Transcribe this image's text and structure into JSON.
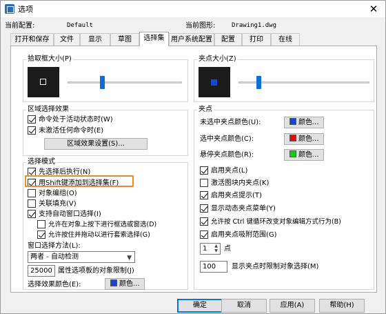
{
  "window": {
    "title": "选项",
    "close": "✕"
  },
  "profile": {
    "current_profile_label": "当前配置:",
    "current_profile_value": "Default",
    "current_drawing_label": "当前图形:",
    "current_drawing_value": "Drawing1.dwg"
  },
  "tabs": [
    "打开和保存",
    "文件",
    "显示",
    "草图",
    "选择集",
    "用户系统配置",
    "配置",
    "打印",
    "在线"
  ],
  "active_tab": "选择集",
  "pickbox": {
    "title": "拾取框大小(P)",
    "slider_level": 0.3
  },
  "grip_size": {
    "title": "夹点大小(Z)",
    "slider_level": 0.15
  },
  "area_effect": {
    "title": "区域选择效果",
    "opt1": "命令处于活动状态时(W)",
    "opt2": "未激活任何命令时(E)",
    "settings_button": "区域效果设置(S)..."
  },
  "selection_mode": {
    "title": "选择模式",
    "opt_noun_verb": "先选择后执行(N)",
    "opt_shift": "用Shift键添加到选择集(F)",
    "opt_group": "对象编组(O)",
    "opt_assoc_hatch": "关联填充(V)",
    "opt_implied": "支持自动窗口选择(I)",
    "opt_allow_press": "允许在对象上按下进行框选或窗选(D)",
    "opt_lasso": "允许按住并拖动以进行套索选择(G)",
    "window_method_label": "窗口选择方法(L):",
    "window_method_value": "两者 - 自动检测",
    "limit_value": "25000",
    "limit_label": "属性选项板的对象限制(J)",
    "effect_color_label": "选择效果颜色(E):",
    "color_button": "颜色..."
  },
  "grips": {
    "title": "夹点",
    "unselected_label": "未选中夹点颜色(U):",
    "selected_label": "选中夹点颜色(C):",
    "hover_label": "悬停夹点颜色(R):",
    "color_button": "颜色...",
    "enable_grips": "启用夹点(L)",
    "grips_in_blocks": "激活图块内夹点(K)",
    "grip_tips": "启用夹点提示(T)",
    "dynamic_menu": "显示动态夹点菜单(Y)",
    "ctrl_cycle": "允许按 Ctrl 键循环改变对象编辑方式行为(B)",
    "grip_snap": "启用夹点吸附范围(G)",
    "snap_value": "1",
    "snap_unit": "点",
    "limit_value": "100",
    "limit_label": "显示夹点时限制对象选择(M)"
  },
  "footer": {
    "ok": "确定",
    "cancel": "取消",
    "apply": "应用(A)",
    "help": "帮助(H)"
  },
  "colors": {
    "blue": "#1546d6",
    "red": "#e01010",
    "green": "#10d010",
    "highlight": "#f08a24",
    "preview_bg": "#1b1b1b"
  },
  "checkbox_states": {
    "area1": true,
    "area2": true,
    "noun_verb": true,
    "shift": true,
    "group": false,
    "assoc_hatch": false,
    "implied": true,
    "allow_press": false,
    "lasso": true,
    "enable_grips": true,
    "grips_in_blocks": false,
    "grip_tips": true,
    "dynamic_menu": true,
    "ctrl_cycle": true,
    "grip_snap": true
  }
}
